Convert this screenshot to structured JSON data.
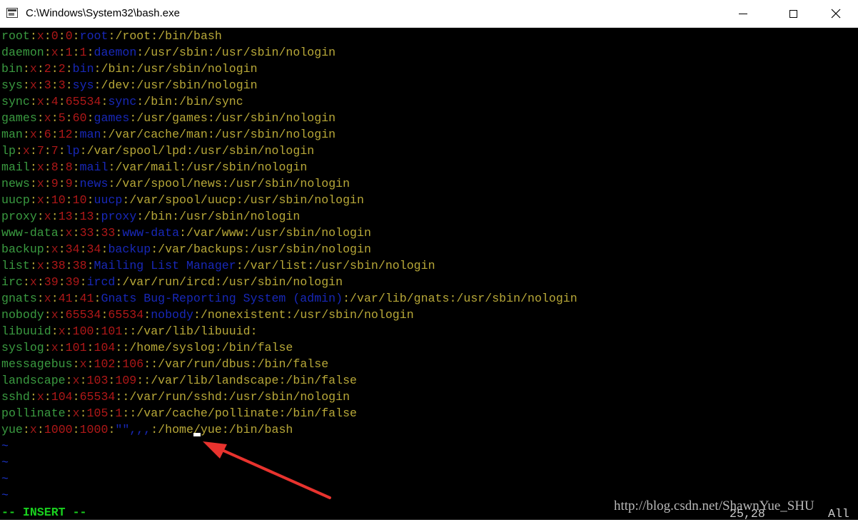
{
  "window": {
    "title": "C:\\Windows\\System32\\bash.exe",
    "icon": "console-app-icon",
    "buttons": {
      "minimize": "minimize-icon",
      "maximize": "maximize-icon",
      "close": "close-icon"
    }
  },
  "terminal": {
    "colors": {
      "name": "#3a9a40",
      "x": "#a01818",
      "number": "#b01818",
      "separator": "#b8a838",
      "gecos": "#1828b8",
      "path": "#b8a838",
      "mode": "#19d01e",
      "tilde": "#1c34c8"
    },
    "lines": [
      {
        "user": "root",
        "x": "x",
        "uid": "0",
        "gid": "0",
        "gecos": "root",
        "home": "/root",
        "shell": "/bin/bash"
      },
      {
        "user": "daemon",
        "x": "x",
        "uid": "1",
        "gid": "1",
        "gecos": "daemon",
        "home": "/usr/sbin",
        "shell": "/usr/sbin/nologin"
      },
      {
        "user": "bin",
        "x": "x",
        "uid": "2",
        "gid": "2",
        "gecos": "bin",
        "home": "/bin",
        "shell": "/usr/sbin/nologin"
      },
      {
        "user": "sys",
        "x": "x",
        "uid": "3",
        "gid": "3",
        "gecos": "sys",
        "home": "/dev",
        "shell": "/usr/sbin/nologin"
      },
      {
        "user": "sync",
        "x": "x",
        "uid": "4",
        "gid": "65534",
        "gecos": "sync",
        "home": "/bin",
        "shell": "/bin/sync"
      },
      {
        "user": "games",
        "x": "x",
        "uid": "5",
        "gid": "60",
        "gecos": "games",
        "home": "/usr/games",
        "shell": "/usr/sbin/nologin"
      },
      {
        "user": "man",
        "x": "x",
        "uid": "6",
        "gid": "12",
        "gecos": "man",
        "home": "/var/cache/man",
        "shell": "/usr/sbin/nologin"
      },
      {
        "user": "lp",
        "x": "x",
        "uid": "7",
        "gid": "7",
        "gecos": "lp",
        "home": "/var/spool/lpd",
        "shell": "/usr/sbin/nologin"
      },
      {
        "user": "mail",
        "x": "x",
        "uid": "8",
        "gid": "8",
        "gecos": "mail",
        "home": "/var/mail",
        "shell": "/usr/sbin/nologin"
      },
      {
        "user": "news",
        "x": "x",
        "uid": "9",
        "gid": "9",
        "gecos": "news",
        "home": "/var/spool/news",
        "shell": "/usr/sbin/nologin"
      },
      {
        "user": "uucp",
        "x": "x",
        "uid": "10",
        "gid": "10",
        "gecos": "uucp",
        "home": "/var/spool/uucp",
        "shell": "/usr/sbin/nologin"
      },
      {
        "user": "proxy",
        "x": "x",
        "uid": "13",
        "gid": "13",
        "gecos": "proxy",
        "home": "/bin",
        "shell": "/usr/sbin/nologin"
      },
      {
        "user": "www-data",
        "x": "x",
        "uid": "33",
        "gid": "33",
        "gecos": "www-data",
        "home": "/var/www",
        "shell": "/usr/sbin/nologin"
      },
      {
        "user": "backup",
        "x": "x",
        "uid": "34",
        "gid": "34",
        "gecos": "backup",
        "home": "/var/backups",
        "shell": "/usr/sbin/nologin"
      },
      {
        "user": "list",
        "x": "x",
        "uid": "38",
        "gid": "38",
        "gecos": "Mailing List Manager",
        "home": "/var/list",
        "shell": "/usr/sbin/nologin"
      },
      {
        "user": "irc",
        "x": "x",
        "uid": "39",
        "gid": "39",
        "gecos": "ircd",
        "home": "/var/run/ircd",
        "shell": "/usr/sbin/nologin"
      },
      {
        "user": "gnats",
        "x": "x",
        "uid": "41",
        "gid": "41",
        "gecos": "Gnats Bug-Reporting System (admin)",
        "home": "/var/lib/gnats",
        "shell": "/usr/sbin/nologin"
      },
      {
        "user": "nobody",
        "x": "x",
        "uid": "65534",
        "gid": "65534",
        "gecos": "nobody",
        "home": "/nonexistent",
        "shell": "/usr/sbin/nologin"
      },
      {
        "user": "libuuid",
        "x": "x",
        "uid": "100",
        "gid": "101",
        "gecos": "",
        "home": "/var/lib/libuuid",
        "shell": ""
      },
      {
        "user": "syslog",
        "x": "x",
        "uid": "101",
        "gid": "104",
        "gecos": "",
        "home": "/home/syslog",
        "shell": "/bin/false"
      },
      {
        "user": "messagebus",
        "x": "x",
        "uid": "102",
        "gid": "106",
        "gecos": "",
        "home": "/var/run/dbus",
        "shell": "/bin/false"
      },
      {
        "user": "landscape",
        "x": "x",
        "uid": "103",
        "gid": "109",
        "gecos": "",
        "home": "/var/lib/landscape",
        "shell": "/bin/false"
      },
      {
        "user": "sshd",
        "x": "x",
        "uid": "104",
        "gid": "65534",
        "gecos": "",
        "home": "/var/run/sshd",
        "shell": "/usr/sbin/nologin"
      },
      {
        "user": "pollinate",
        "x": "x",
        "uid": "105",
        "gid": "1",
        "gecos": "",
        "home": "/var/cache/pollinate",
        "shell": "/bin/false"
      },
      {
        "user": "yue",
        "x": "x",
        "uid": "1000",
        "gid": "1000",
        "gecos": "\"\",,,",
        "home": "/home/yue",
        "shell": "/bin/bash"
      }
    ],
    "tildes": [
      "~",
      "~",
      "~",
      "~"
    ],
    "status": {
      "mode": "-- INSERT --",
      "position": "25,28",
      "scroll": "All"
    },
    "watermark": "http://blog.csdn.net/ShawnYue_SHU"
  }
}
